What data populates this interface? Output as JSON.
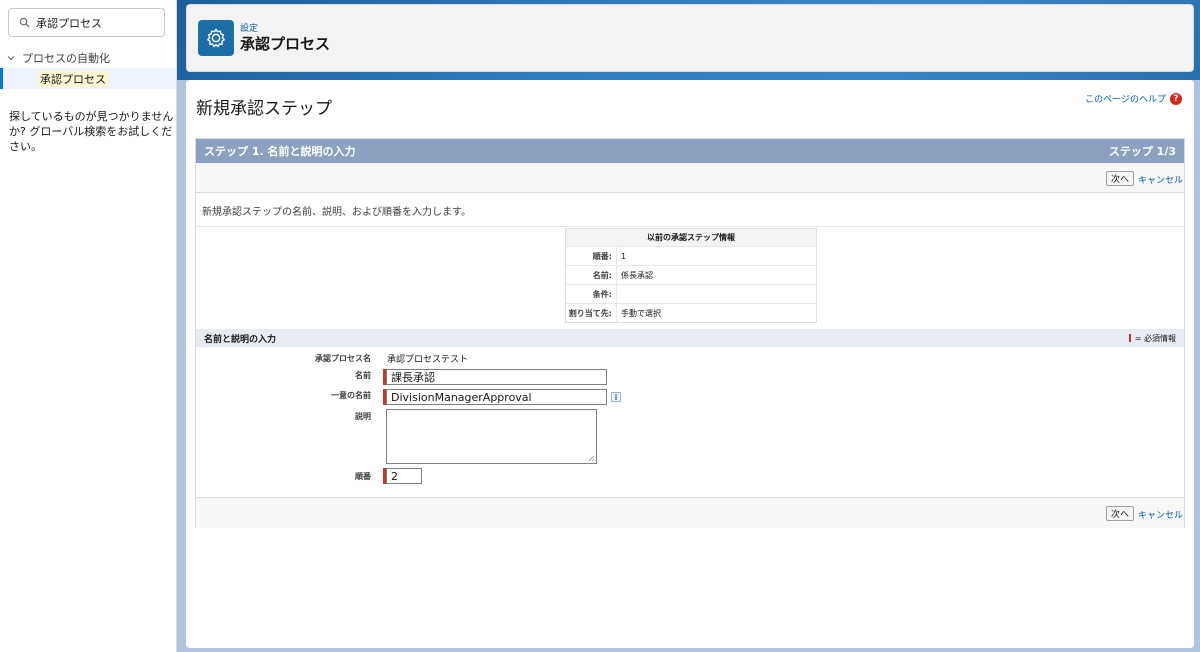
{
  "sidebar": {
    "search_value": "承認プロセス",
    "tree_parent": "プロセスの自動化",
    "tree_child": "承認プロセス",
    "not_found_text": "探しているものが見つかりませんか? グローバル検索をお試しください。"
  },
  "header": {
    "subtitle": "設定",
    "title": "承認プロセス"
  },
  "page": {
    "title": "新規承認ステップ",
    "help_link": "このページのヘルプ",
    "help_icon_glyph": "?"
  },
  "step": {
    "head_left": "ステップ 1. 名前と説明の入力",
    "head_right": "ステップ 1/3",
    "next_label": "次へ",
    "cancel_label": "キャンセル",
    "description": "新規承認ステップの名前、説明、および順番を入力します。"
  },
  "previous_step": {
    "title": "以前の承認ステップ情報",
    "rows": [
      {
        "label": "順番:",
        "value": "1"
      },
      {
        "label": "名前:",
        "value": "係長承認"
      },
      {
        "label": "条件:",
        "value": ""
      },
      {
        "label": "割り当て先:",
        "value": "手動で選択"
      }
    ]
  },
  "section": {
    "title": "名前と説明の入力",
    "required_legend": "= 必須情報"
  },
  "form": {
    "process_name_label": "承認プロセス名",
    "process_name_value": "承認プロセステスト",
    "name_label": "名前",
    "name_value": "課長承認",
    "unique_name_label": "一意の名前",
    "unique_name_value": "DivisionManagerApproval",
    "description_label": "説明",
    "description_value": "",
    "order_label": "順番",
    "order_value": "2",
    "info_glyph": "i"
  },
  "colors": {
    "accent": "#0176d3",
    "step_header": "#8ca0c0",
    "required": "#c23934",
    "header_icon": "#1b6fa6"
  },
  "icons": {
    "search": "search-icon",
    "chevron": "chevron-down-icon",
    "setup": "gear-icon",
    "help": "help-icon",
    "info": "info-icon"
  }
}
